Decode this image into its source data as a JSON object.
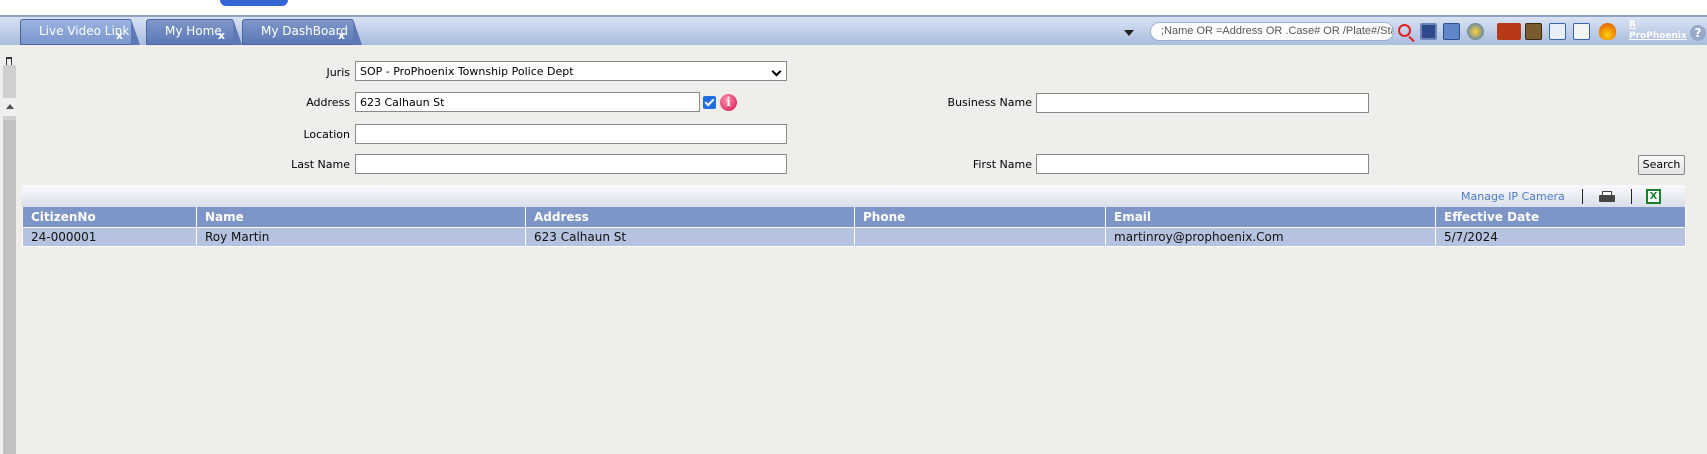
{
  "tabs": [
    {
      "label": "Live Video Link",
      "close": "x"
    },
    {
      "label": "My Home",
      "close": "x"
    },
    {
      "label": "My DashBoard",
      "close": "x"
    }
  ],
  "search": {
    "placeholder": ";Name OR =Address OR .Case# OR /Plate#/Sta"
  },
  "toolbar_icons": [
    "search-icon",
    "monitor-icon",
    "printer-icon",
    "globe-icon",
    "mail-icon",
    "book-icon",
    "calendar-clock-icon",
    "notes-icon",
    "fire-icon"
  ],
  "user": {
    "line1": "R",
    "line2": "ProPhoenix"
  },
  "help": "?",
  "form": {
    "juris_label": "Juris",
    "juris_value": "SOP - ProPhoenix Township Police Dept",
    "address_label": "Address",
    "address_value": "623 Calhaun St",
    "business_name_label": "Business Name",
    "business_name_value": "",
    "location_label": "Location",
    "location_value": "",
    "last_name_label": "Last Name",
    "last_name_value": "",
    "first_name_label": "First Name",
    "first_name_value": "",
    "search_button": "Search",
    "info_glyph": "i"
  },
  "grid": {
    "manage_ip_camera": "Manage IP Camera",
    "excel_glyph": "X",
    "columns": [
      "CitizenNo",
      "Name",
      "Address",
      "Phone",
      "Email",
      "Effective Date"
    ],
    "rows": [
      [
        "24-000001",
        "Roy Martin",
        "623 Calhaun St",
        "",
        "martinroy@prophoenix.Com",
        "5/7/2024"
      ]
    ]
  },
  "colors": {
    "tab_bg": "#5c79b6",
    "header_bg": "#7e95c8",
    "row_bg": "#b6c3e0",
    "link": "#4f7cc5"
  }
}
